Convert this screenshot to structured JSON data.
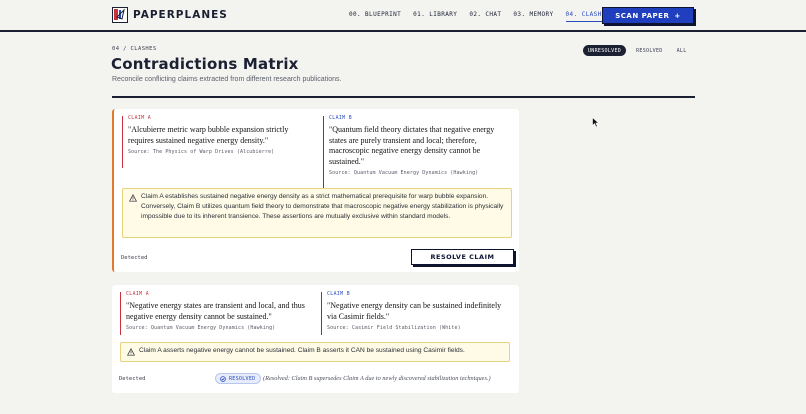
{
  "app": {
    "name": "PAPERPLANES"
  },
  "nav": {
    "items": [
      {
        "label": "00. BLUEPRINT"
      },
      {
        "label": "01. LIBRARY"
      },
      {
        "label": "02. CHAT"
      },
      {
        "label": "03. MEMORY"
      },
      {
        "label": "04. CLASHES"
      }
    ],
    "active_index": 4,
    "scan_label": "SCAN PAPER",
    "scan_icon": "+"
  },
  "page": {
    "breadcrumb": "04 / CLASHES",
    "title": "Contradictions Matrix",
    "subtitle": "Reconcile conflicting claims extracted from different research publications."
  },
  "filters": {
    "items": [
      {
        "label": "UNRESOLVED"
      },
      {
        "label": "RESOLVED"
      },
      {
        "label": "ALL"
      }
    ],
    "active": "UNRESOLVED"
  },
  "clashes": [
    {
      "claim_a": {
        "tag": "CLAIM A",
        "text": "\"Alcubierre metric warp bubble expansion strictly requires sustained negative energy density.\"",
        "source": "Source: The Physics of Warp Drives (Alcubierre)"
      },
      "claim_b": {
        "tag": "CLAIM B",
        "text": "\"Quantum field theory dictates that negative energy states are purely transient and local; therefore, macroscopic negative energy density cannot be sustained.\"",
        "source": "Source: Quantum Vacuum Energy Dynamics (Hawking)"
      },
      "explanation": "Claim A establishes sustained negative energy density as a strict mathematical prerequisite for warp bubble expansion. Conversely, Claim B utilizes quantum field theory to demonstrate that macroscopic negative energy stabilization is physically impossible due to its inherent transience. These assertions are mutually exclusive within standard models.",
      "status": "Detected",
      "action_label": "RESOLVE CLAIM"
    },
    {
      "claim_a": {
        "tag": "CLAIM A",
        "text": "\"Negative energy states are transient and local, and thus negative energy density cannot be sustained.\"",
        "source": "Source: Quantum Vacuum Energy Dynamics (Hawking)"
      },
      "claim_b": {
        "tag": "CLAIM B",
        "text": "\"Negative energy density can be sustained indefinitely via Casimir fields.\"",
        "source": "Source: Casimir Field Stabilization (White)"
      },
      "explanation": "Claim A asserts negative energy cannot be sustained. Claim B asserts it CAN be sustained using Casimir fields.",
      "status": "Detected",
      "badge_label": "RESOLVED",
      "resolution_note": "(Resolved: Claim B supersedes Claim A due to newly discovered stabilization techniques.)"
    }
  ],
  "colors": {
    "ink": "#1b2033",
    "accent_blue": "#1f3fbf",
    "claim_a": "#c8323c",
    "claim_b": "#2a4bc0",
    "unresolved_edge": "#e07a2e",
    "warning_bg": "#fffbe6"
  },
  "icons": {
    "logo": "paper-plane-logo-icon",
    "warning": "warning-triangle-icon",
    "resolved": "check-circle-icon",
    "cursor": "mouse-pointer-icon"
  }
}
